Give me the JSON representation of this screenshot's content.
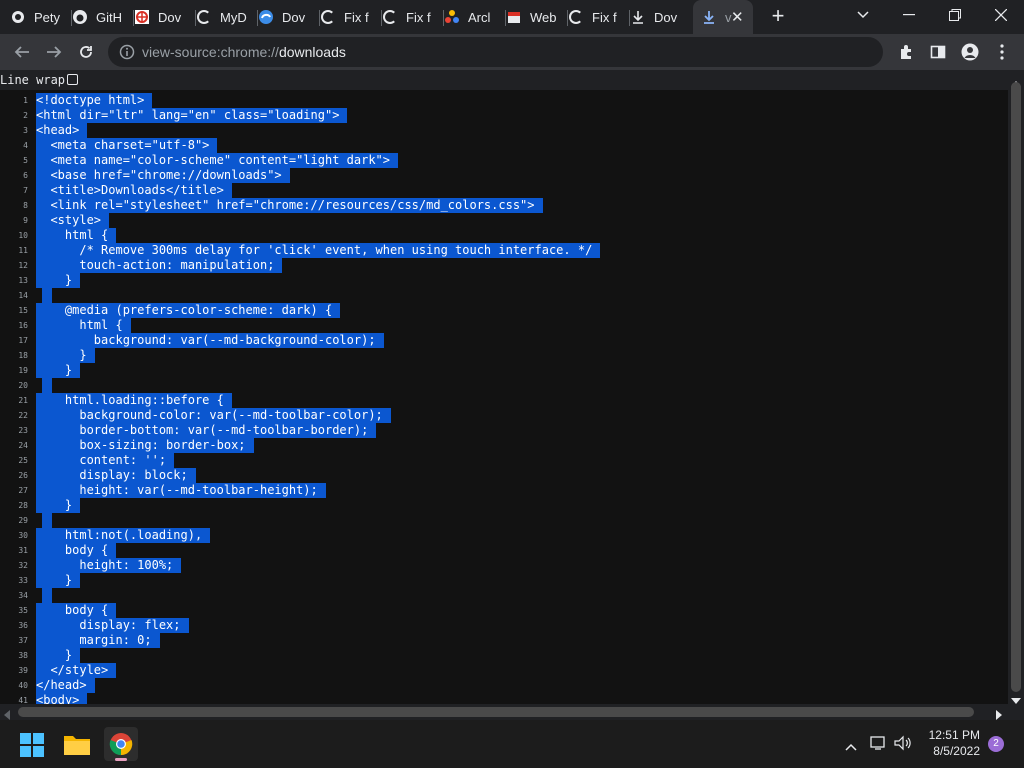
{
  "tabs": [
    {
      "label": "Pety",
      "icon": "record-icon"
    },
    {
      "label": "GitH",
      "icon": "github-icon"
    },
    {
      "label": "Dov",
      "icon": "shield-icon"
    },
    {
      "label": "MyD",
      "icon": "google-icon"
    },
    {
      "label": "Dov",
      "icon": "edge-icon"
    },
    {
      "label": "Fix f",
      "icon": "google-icon"
    },
    {
      "label": "Fix f",
      "icon": "google-icon"
    },
    {
      "label": "Arcl",
      "icon": "dots-icon"
    },
    {
      "label": "Web",
      "icon": "bag-icon"
    },
    {
      "label": "Fix f",
      "icon": "google-icon"
    },
    {
      "label": "Dov",
      "icon": "download-icon"
    },
    {
      "label": "v",
      "icon": "download-icon"
    }
  ],
  "address": {
    "prefix": "view-source:chrome://",
    "host": "downloads"
  },
  "line_wrap_label": "Line wrap",
  "source_lines": [
    "<!doctype html>",
    "<html dir=\"ltr\" lang=\"en\" class=\"loading\">",
    "<head>",
    "  <meta charset=\"utf-8\">",
    "  <meta name=\"color-scheme\" content=\"light dark\">",
    "  <base href=\"chrome://downloads\">",
    "  <title>Downloads</title>",
    "  <link rel=\"stylesheet\" href=\"chrome://resources/css/md_colors.css\">",
    "  <style>",
    "    html {",
    "      /* Remove 300ms delay for 'click' event, when using touch interface. */",
    "      touch-action: manipulation;",
    "    }",
    "",
    "    @media (prefers-color-scheme: dark) {",
    "      html {",
    "        background: var(--md-background-color);",
    "      }",
    "    }",
    "",
    "    html.loading::before {",
    "      background-color: var(--md-toolbar-color);",
    "      border-bottom: var(--md-toolbar-border);",
    "      box-sizing: border-box;",
    "      content: '';",
    "      display: block;",
    "      height: var(--md-toolbar-height);",
    "    }",
    "",
    "    html:not(.loading),",
    "    body {",
    "      height: 100%;",
    "    }",
    "",
    "    body {",
    "      display: flex;",
    "      margin: 0;",
    "    }",
    "  </style>",
    "</head>",
    "<body>"
  ],
  "taskbar": {
    "time": "12:51 PM",
    "date": "8/5/2022",
    "notification_count": "2"
  },
  "colors": {
    "selection": "#0b57d0",
    "background": "#121212",
    "chrome": "#202124"
  }
}
